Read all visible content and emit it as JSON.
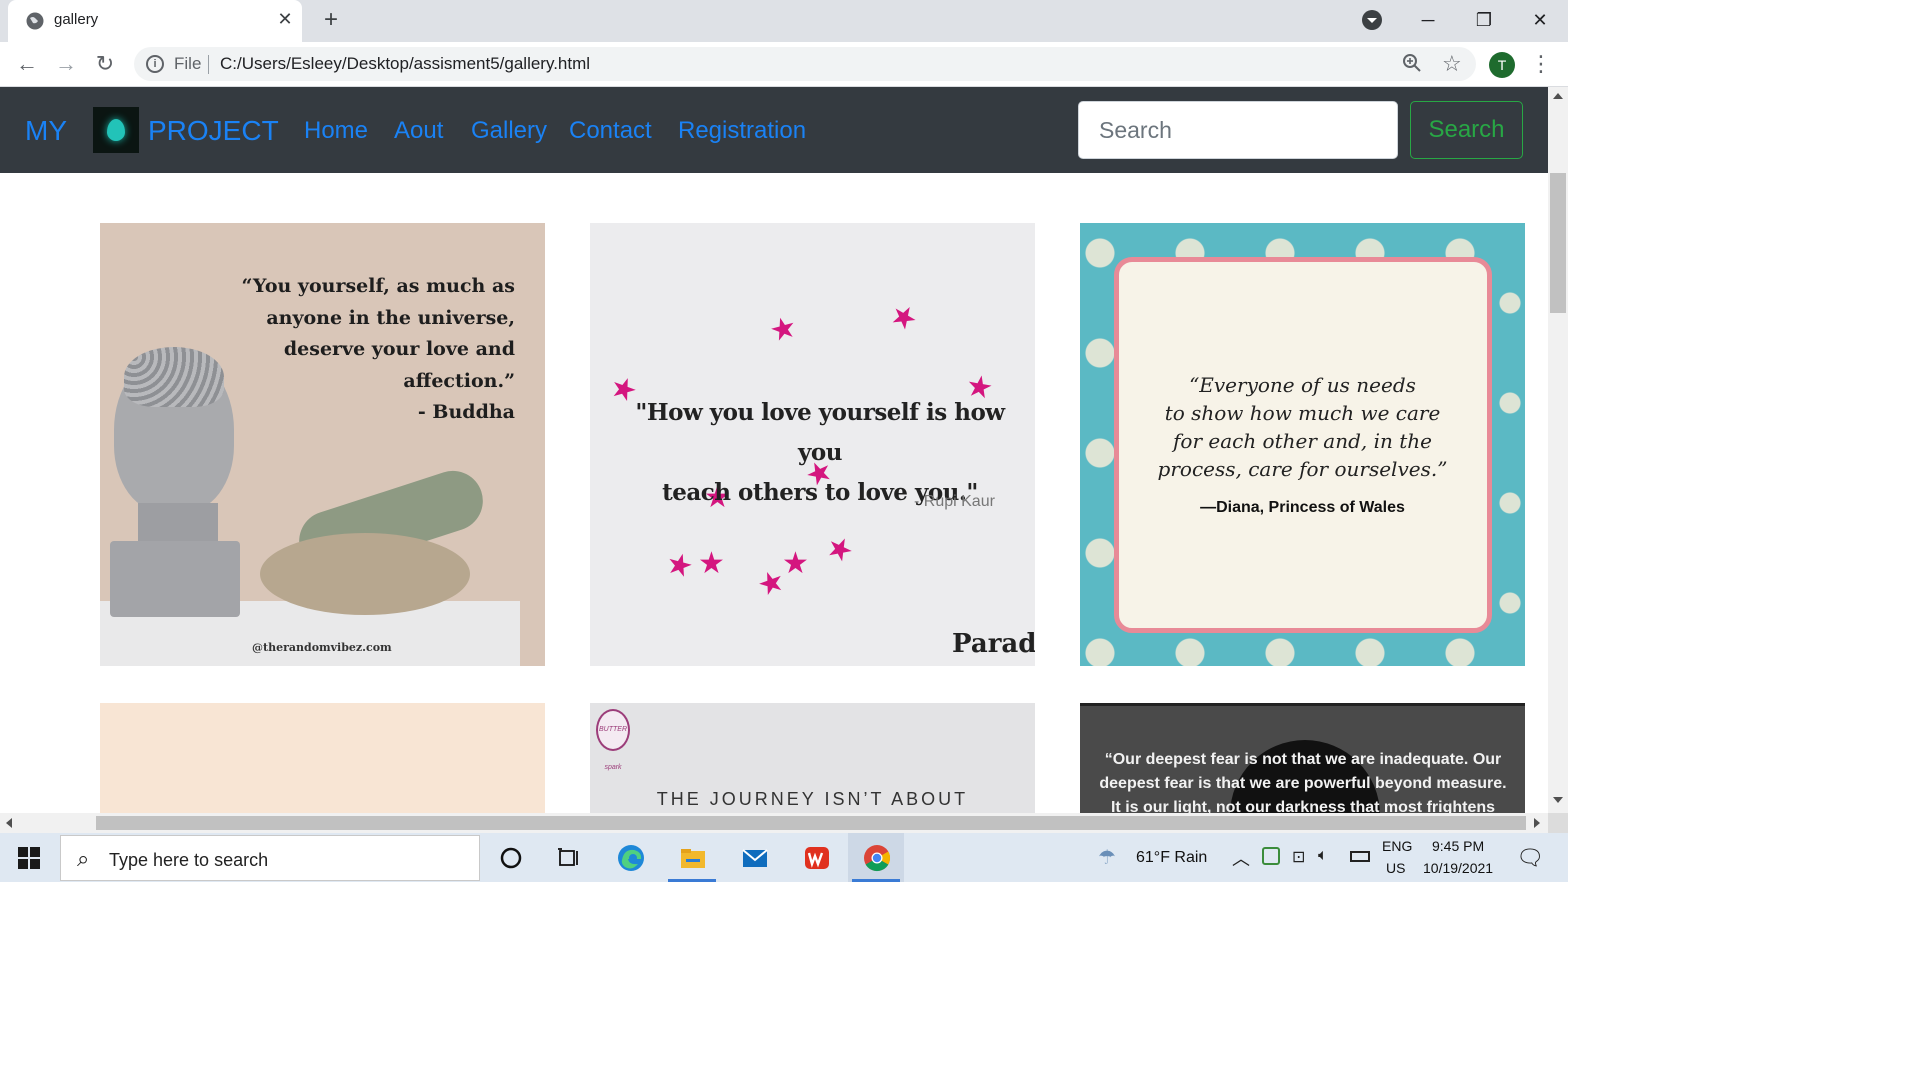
{
  "browser": {
    "tab_title": "gallery",
    "address_scheme": "File",
    "address_url": "C:/Users/Esleey/Desktop/assisment5/gallery.html",
    "profile_initial": "T",
    "window_controls": [
      "minimize-icon",
      "restore-icon",
      "close-icon"
    ]
  },
  "navbar": {
    "brand_left": "MY",
    "brand_right": "PROJECT",
    "links": [
      "Home",
      "Aout",
      "Gallery",
      "Contact",
      "Registration"
    ],
    "search_placeholder": "Search",
    "search_button": "Search",
    "accent_color": "#1a82f5",
    "button_color": "#28a745",
    "background": "#343a40"
  },
  "gallery": [
    {
      "lines": [
        "“You yourself, as much as",
        "anyone in the universe,",
        "deserve your love and",
        "affection.”",
        "- Buddha"
      ],
      "credit": "@therandomvibez.com"
    },
    {
      "lines": [
        "\"How you love yourself is how you",
        "teach others to love you.\""
      ],
      "attribution": "- Rupi Kaur",
      "brand": "Parade"
    },
    {
      "lines": [
        "“Everyone of us needs",
        "to show how much we care",
        "for each other and, in the",
        "process, care for ourselves.”"
      ],
      "attribution": "—Diana, Princess of Wales"
    },
    {
      "lines": []
    },
    {
      "badge": "BUTTER spark",
      "lines": [
        "THE JOURNEY ISN’T ABOUT"
      ]
    },
    {
      "lines": [
        "“Our deepest fear is not that we are inadequate. Our",
        "deepest fear is that we are powerful beyond measure.",
        "It is our light, not our darkness that most frightens us."
      ]
    }
  ],
  "taskbar": {
    "search_placeholder": "Type here to search",
    "weather": "61°F  Rain",
    "lang_top": "ENG",
    "lang_bottom": "US",
    "time": "9:45 PM",
    "date": "10/19/2021"
  }
}
